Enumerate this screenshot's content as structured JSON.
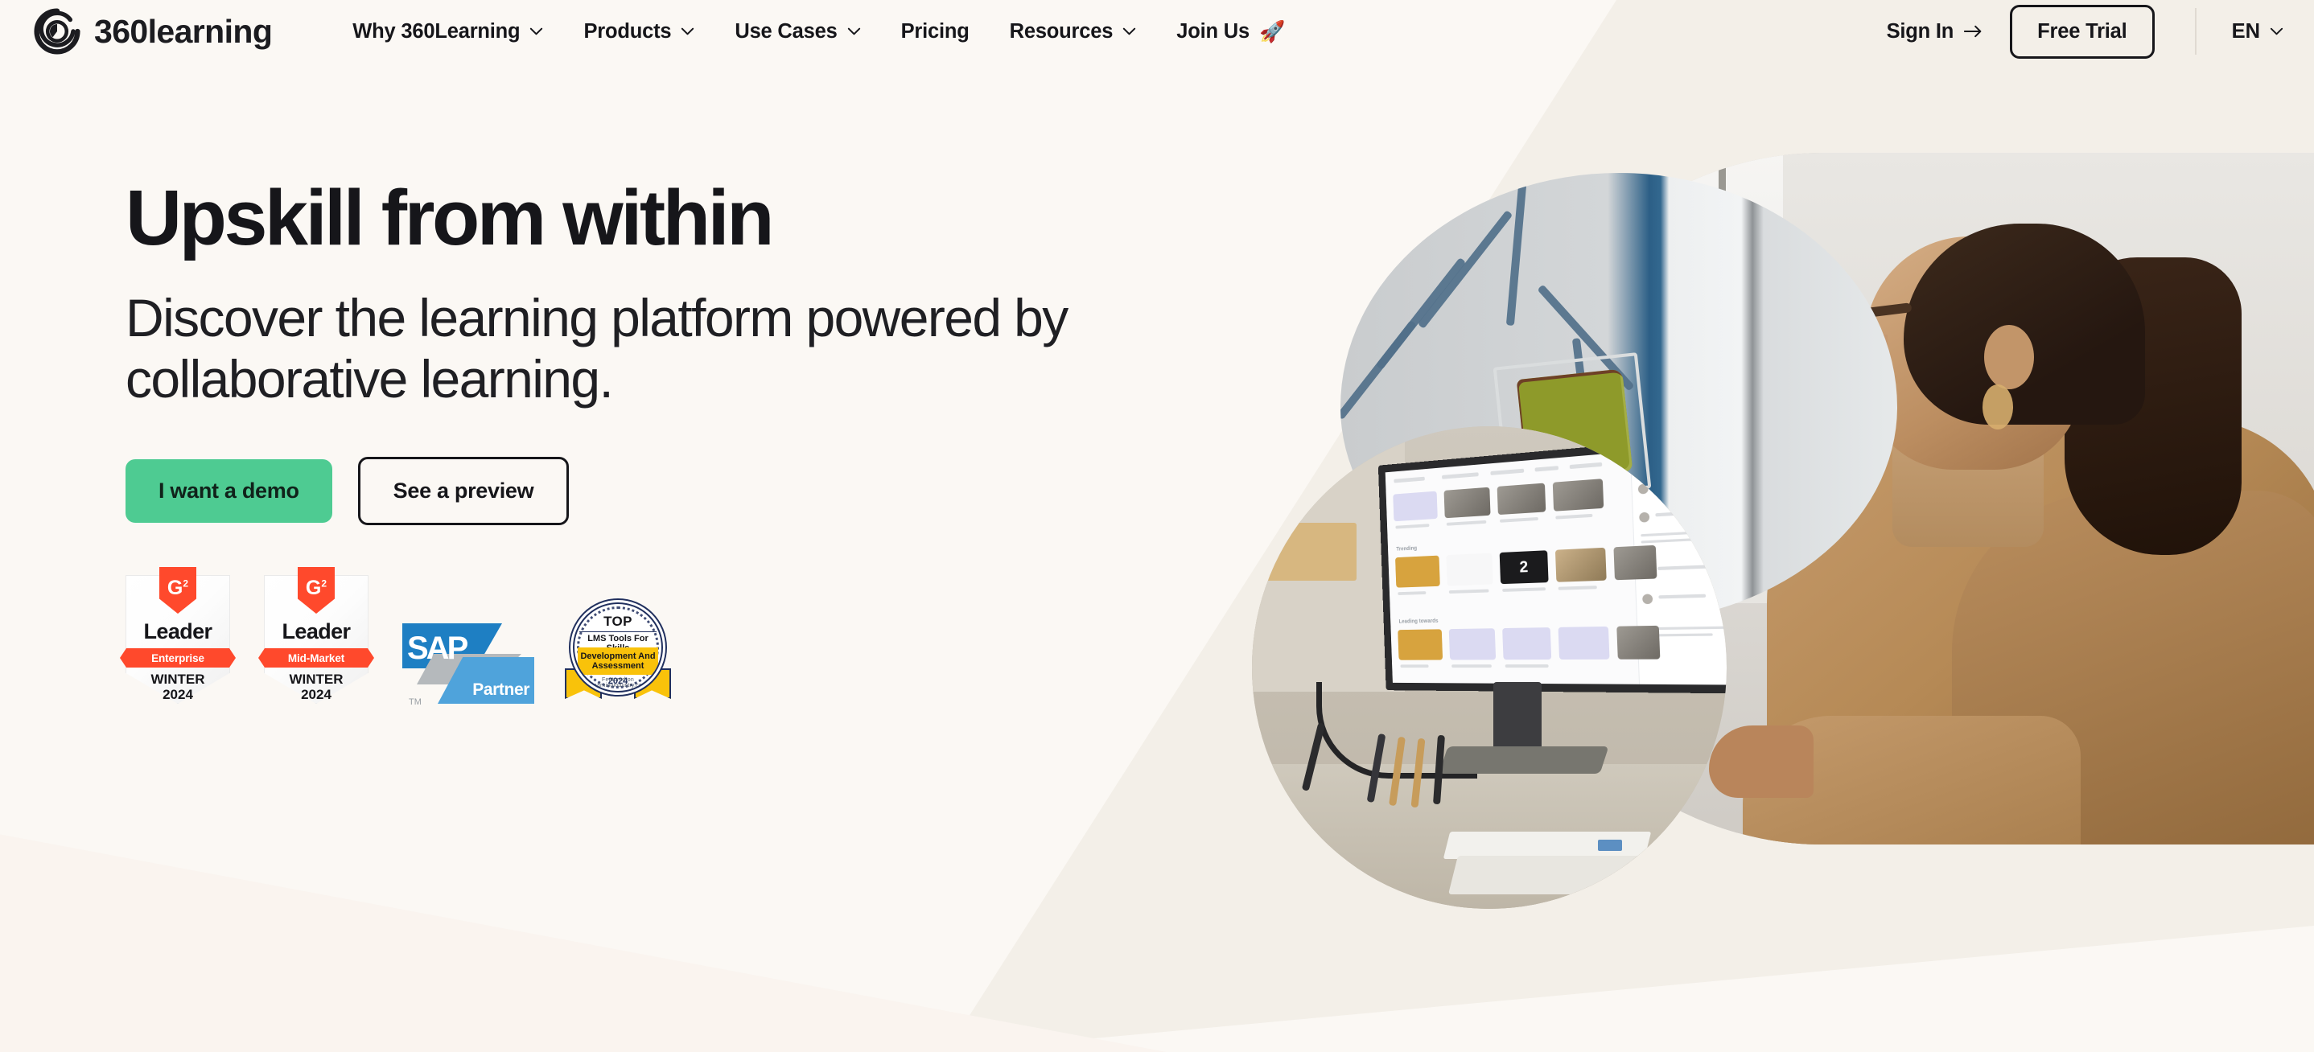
{
  "brand": {
    "name": "360learning",
    "logo_icon": "360learning-circle-logo",
    "accent_green": "#4ECB92",
    "ink": "#16161A",
    "background_cream": "#F3EFE8",
    "background_light": "#FBF8F4"
  },
  "header": {
    "nav_items": [
      {
        "label": "Why 360Learning",
        "has_dropdown": true,
        "icon": "chevron-down-icon"
      },
      {
        "label": "Products",
        "has_dropdown": true,
        "icon": "chevron-down-icon"
      },
      {
        "label": "Use Cases",
        "has_dropdown": true,
        "icon": "chevron-down-icon"
      },
      {
        "label": "Pricing",
        "has_dropdown": false,
        "icon": ""
      },
      {
        "label": "Resources",
        "has_dropdown": true,
        "icon": "chevron-down-icon"
      },
      {
        "label": "Join Us",
        "has_dropdown": false,
        "icon": "rocket-emoji",
        "emoji": "🚀"
      }
    ],
    "sign_in_label": "Sign In",
    "sign_in_icon": "arrow-right-icon",
    "free_trial_label": "Free Trial",
    "language_label": "EN",
    "language_icon": "chevron-down-icon"
  },
  "hero": {
    "headline": "Upskill from within",
    "subheadline": "Discover the learning platform powered by collaborative learning.",
    "primary_cta": "I want a demo",
    "secondary_cta": "See a preview"
  },
  "badges": [
    {
      "type": "g2",
      "name": "g2-leader-enterprise-badge",
      "brand": "G2",
      "brand_glyph": "G",
      "brand_sup": "2",
      "rank": "Leader",
      "segment": "Enterprise",
      "season": "WINTER",
      "year": "2024",
      "ribbon_color": "#FF492C"
    },
    {
      "type": "g2",
      "name": "g2-leader-mid-market-badge",
      "brand": "G2",
      "brand_glyph": "G",
      "brand_sup": "2",
      "rank": "Leader",
      "segment": "Mid-Market",
      "season": "WINTER",
      "year": "2024",
      "ribbon_color": "#FF492C"
    },
    {
      "type": "sap",
      "name": "sap-partner-badge",
      "word": "SAP",
      "partner": "Partner",
      "tm": "TM",
      "color": "#1E7FC3"
    },
    {
      "type": "lms",
      "name": "top-lms-tools-badge",
      "top": "TOP",
      "line1": "LMS Tools For Skills",
      "line2": "Development And",
      "line3": "Assessment",
      "year": "2024",
      "featured": "Featured on elearningindustry.com",
      "color": "#F9C20A",
      "navy": "#21305E"
    }
  ],
  "photos": {
    "office_wall": "office-wall-with-moss-art-photo",
    "monitor": "desk-monitor-showing-course-catalog-photo",
    "person": "woman-working-at-desk-photo"
  }
}
